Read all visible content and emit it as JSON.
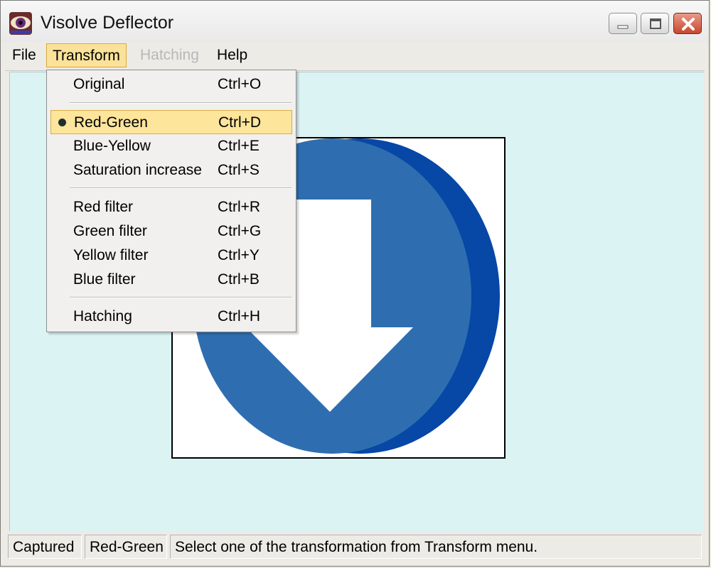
{
  "window": {
    "title": "Visolve Deflector",
    "icon": "eye-icon",
    "controls": [
      "minimize-icon",
      "maximize-icon",
      "close-icon"
    ]
  },
  "menubar": {
    "items": [
      {
        "label": "File",
        "state": "normal"
      },
      {
        "label": "Transform",
        "state": "open"
      },
      {
        "label": "Hatching",
        "state": "disabled"
      },
      {
        "label": "Help",
        "state": "normal"
      }
    ]
  },
  "transform_menu": {
    "groups": [
      [
        {
          "label": "Original",
          "shortcut": "Ctrl+O"
        }
      ],
      [
        {
          "label": "Red-Green",
          "shortcut": "Ctrl+D",
          "checked": true
        },
        {
          "label": "Blue-Yellow",
          "shortcut": "Ctrl+E"
        },
        {
          "label": "Saturation increase",
          "shortcut": "Ctrl+S"
        }
      ],
      [
        {
          "label": "Red filter",
          "shortcut": "Ctrl+R"
        },
        {
          "label": "Green filter",
          "shortcut": "Ctrl+G"
        },
        {
          "label": "Yellow filter",
          "shortcut": "Ctrl+Y"
        },
        {
          "label": "Blue filter",
          "shortcut": "Ctrl+B"
        }
      ],
      [
        {
          "label": "Hatching",
          "shortcut": "Ctrl+H"
        }
      ]
    ]
  },
  "canvas": {
    "content": "download-arrow-icon",
    "colors": {
      "circle_front": "#2e6eb0",
      "circle_back": "#0747a6",
      "arrow": "#ffffff",
      "background": "#dbf3f3"
    }
  },
  "statusbar": {
    "capture_state": "Captured",
    "mode": "Red-Green",
    "message": "Select one of the transformation from Transform menu."
  }
}
